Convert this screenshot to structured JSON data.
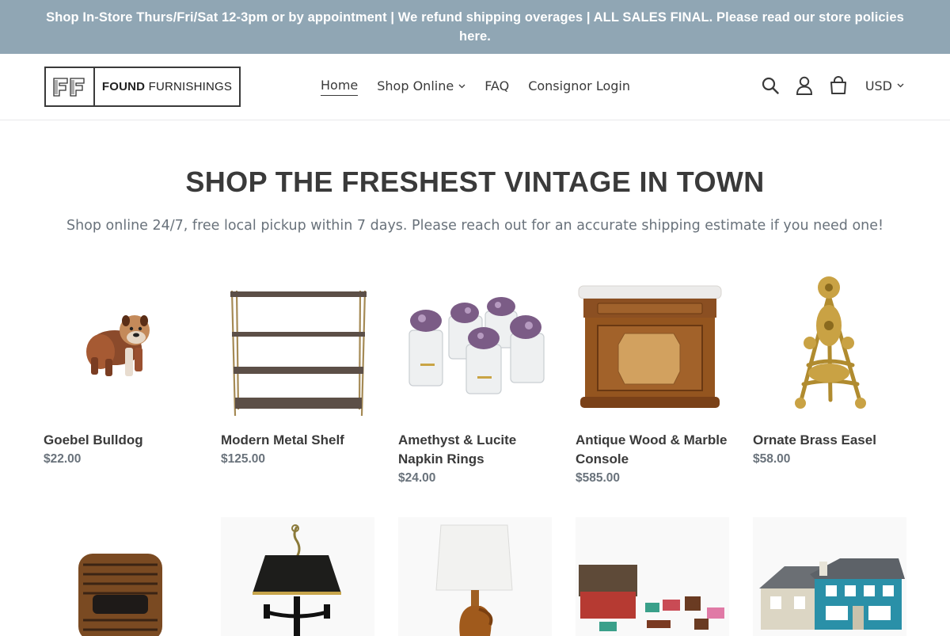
{
  "announcement": {
    "text": "Shop In-Store Thurs/Fri/Sat 12-3pm or by appointment | We refund shipping overages | ALL SALES FINAL. Please read our store policies here."
  },
  "header": {
    "logo": {
      "mark": "FF",
      "word_bold": "FOUND",
      "word_light": "FURNISHINGS"
    },
    "nav": [
      {
        "label": "Home",
        "active": true
      },
      {
        "label": "Shop Online",
        "has_dropdown": true
      },
      {
        "label": "FAQ"
      },
      {
        "label": "Consignor Login"
      }
    ],
    "icons": [
      "search-icon",
      "account-icon",
      "cart-icon"
    ],
    "currency": "USD"
  },
  "hero": {
    "title": "SHOP THE FRESHEST VINTAGE IN TOWN",
    "subtitle": "Shop online 24/7, free local pickup within 7 days. Please reach out for an accurate shipping estimate if you need one!"
  },
  "products_row1": [
    {
      "title": "Goebel Bulldog",
      "price": "$22.00"
    },
    {
      "title": "Modern Metal Shelf",
      "price": "$125.00"
    },
    {
      "title": "Amethyst & Lucite Napkin Rings",
      "price": "$24.00"
    },
    {
      "title": "Antique Wood & Marble Console",
      "price": "$585.00"
    },
    {
      "title": "Ornate Brass Easel",
      "price": "$58.00"
    }
  ],
  "colors": {
    "announcement_bg": "#90a6b4",
    "text": "#3a3a3a",
    "muted": "#69727b"
  }
}
